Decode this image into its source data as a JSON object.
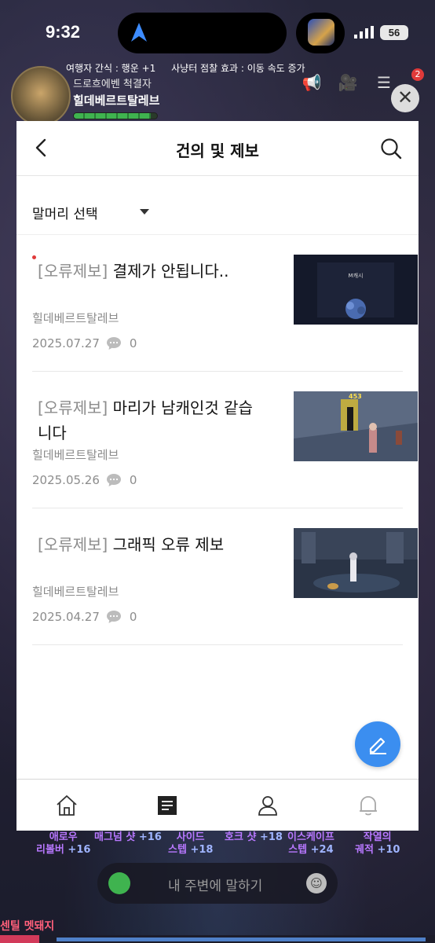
{
  "status_bar": {
    "time": "9:32",
    "battery": "56"
  },
  "game_hud": {
    "buffs": [
      "여행자 간식 : 행운 +1",
      "사냥터 점찰 효과 : 이동 속도 증가"
    ],
    "character_class": "드로흐에벤 척결자",
    "character_name": "힐데베르트탈레브",
    "hp_fraction": 0.92,
    "notification_count": "2",
    "skills": [
      {
        "name": "애로우",
        "name2": "리볼버",
        "bonus": "+16"
      },
      {
        "name": "매그넘 샷",
        "name2": "",
        "bonus": "+16"
      },
      {
        "name": "사이드",
        "name2": "스텝",
        "bonus": "+18"
      },
      {
        "name": "호크 샷",
        "name2": "",
        "bonus": "+18"
      },
      {
        "name": "이스케이프",
        "name2": "스텝",
        "bonus": "+24"
      },
      {
        "name": "작열의",
        "name2": "궤적",
        "bonus": "+10"
      }
    ],
    "chat_placeholder": "내 주변에 말하기",
    "boss_name": "센틸 멧돼지",
    "boss_hp_fraction": 0.09
  },
  "board": {
    "title": "건의 및 제보",
    "filter_label": "말머리 선택",
    "posts": [
      {
        "tag": "[오류제보]",
        "title": "결제가 안됩니다..",
        "author": "힐데베르트탈레브",
        "date": "2025.07.27",
        "comments": "0",
        "unread": true,
        "thumb_text": "M캐시"
      },
      {
        "tag": "[오류제보]",
        "title": "마리가 남캐인것 같습니다",
        "author": "힐데베르트탈레브",
        "date": "2025.05.26",
        "comments": "0",
        "unread": false,
        "thumb_text": "453"
      },
      {
        "tag": "[오류제보]",
        "title": "그래픽 오류 제보",
        "author": "힐데베르트탈레브",
        "date": "2025.04.27",
        "comments": "0",
        "unread": false,
        "thumb_text": ""
      }
    ]
  },
  "nav": {
    "items": [
      "home-icon",
      "document-icon",
      "person-icon",
      "bell-icon"
    ],
    "active_index": 1
  },
  "colors": {
    "accent": "#3b8ef0",
    "unread_dot": "#e03a3a",
    "tag_gray": "#8c8c8c"
  }
}
